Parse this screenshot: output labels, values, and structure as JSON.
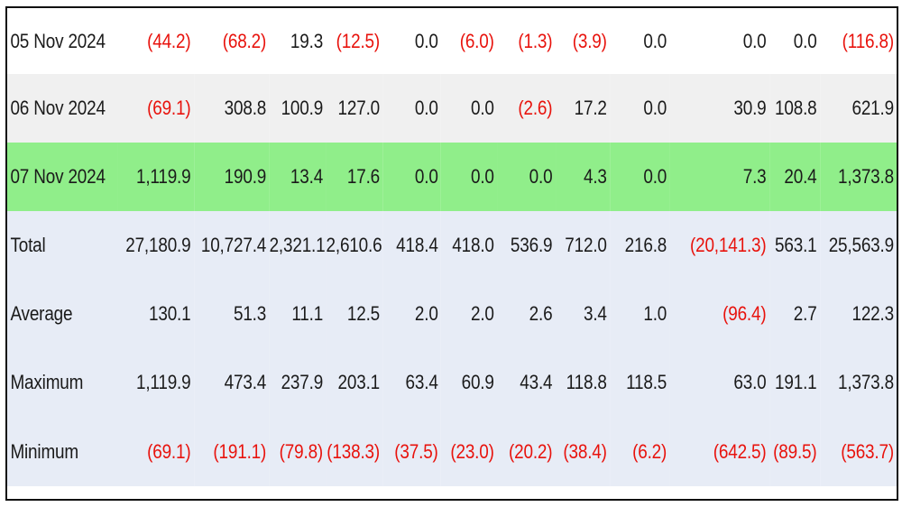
{
  "table": {
    "rows": [
      {
        "label": "05 Nov 2024",
        "style": "white",
        "cells": [
          {
            "v": "(44.2)",
            "neg": true
          },
          {
            "v": "(68.2)",
            "neg": true
          },
          {
            "v": "19.3",
            "neg": false
          },
          {
            "v": "(12.5)",
            "neg": true
          },
          {
            "v": "0.0",
            "neg": false
          },
          {
            "v": "(6.0)",
            "neg": true
          },
          {
            "v": "(1.3)",
            "neg": true
          },
          {
            "v": "(3.9)",
            "neg": true
          },
          {
            "v": "0.0",
            "neg": false
          },
          {
            "v": "0.0",
            "neg": false
          },
          {
            "v": "0.0",
            "neg": false
          },
          {
            "v": "(116.8)",
            "neg": true
          }
        ]
      },
      {
        "label": "06 Nov 2024",
        "style": "grey",
        "cells": [
          {
            "v": "(69.1)",
            "neg": true
          },
          {
            "v": "308.8",
            "neg": false
          },
          {
            "v": "100.9",
            "neg": false
          },
          {
            "v": "127.0",
            "neg": false
          },
          {
            "v": "0.0",
            "neg": false
          },
          {
            "v": "0.0",
            "neg": false
          },
          {
            "v": "(2.6)",
            "neg": true
          },
          {
            "v": "17.2",
            "neg": false
          },
          {
            "v": "0.0",
            "neg": false
          },
          {
            "v": "30.9",
            "neg": false
          },
          {
            "v": "108.8",
            "neg": false
          },
          {
            "v": "621.9",
            "neg": false
          }
        ]
      },
      {
        "label": "07 Nov 2024",
        "style": "green",
        "cells": [
          {
            "v": "1,119.9",
            "neg": false
          },
          {
            "v": "190.9",
            "neg": false
          },
          {
            "v": "13.4",
            "neg": false
          },
          {
            "v": "17.6",
            "neg": false
          },
          {
            "v": "0.0",
            "neg": false
          },
          {
            "v": "0.0",
            "neg": false
          },
          {
            "v": "0.0",
            "neg": false
          },
          {
            "v": "4.3",
            "neg": false
          },
          {
            "v": "0.0",
            "neg": false
          },
          {
            "v": "7.3",
            "neg": false
          },
          {
            "v": "20.4",
            "neg": false
          },
          {
            "v": "1,373.8",
            "neg": false
          }
        ]
      },
      {
        "label": "Total",
        "style": "summary",
        "cells": [
          {
            "v": "27,180.9",
            "neg": false
          },
          {
            "v": "10,727.4",
            "neg": false
          },
          {
            "v": "2,321.1",
            "neg": false
          },
          {
            "v": "2,610.6",
            "neg": false
          },
          {
            "v": "418.4",
            "neg": false
          },
          {
            "v": "418.0",
            "neg": false
          },
          {
            "v": "536.9",
            "neg": false
          },
          {
            "v": "712.0",
            "neg": false
          },
          {
            "v": "216.8",
            "neg": false
          },
          {
            "v": "(20,141.3)",
            "neg": true
          },
          {
            "v": "563.1",
            "neg": false
          },
          {
            "v": "25,563.9",
            "neg": false
          }
        ]
      },
      {
        "label": "Average",
        "style": "summary",
        "cells": [
          {
            "v": "130.1",
            "neg": false
          },
          {
            "v": "51.3",
            "neg": false
          },
          {
            "v": "11.1",
            "neg": false
          },
          {
            "v": "12.5",
            "neg": false
          },
          {
            "v": "2.0",
            "neg": false
          },
          {
            "v": "2.0",
            "neg": false
          },
          {
            "v": "2.6",
            "neg": false
          },
          {
            "v": "3.4",
            "neg": false
          },
          {
            "v": "1.0",
            "neg": false
          },
          {
            "v": "(96.4)",
            "neg": true
          },
          {
            "v": "2.7",
            "neg": false
          },
          {
            "v": "122.3",
            "neg": false
          }
        ]
      },
      {
        "label": "Maximum",
        "style": "summary",
        "cells": [
          {
            "v": "1,119.9",
            "neg": false
          },
          {
            "v": "473.4",
            "neg": false
          },
          {
            "v": "237.9",
            "neg": false
          },
          {
            "v": "203.1",
            "neg": false
          },
          {
            "v": "63.4",
            "neg": false
          },
          {
            "v": "60.9",
            "neg": false
          },
          {
            "v": "43.4",
            "neg": false
          },
          {
            "v": "118.8",
            "neg": false
          },
          {
            "v": "118.5",
            "neg": false
          },
          {
            "v": "63.0",
            "neg": false
          },
          {
            "v": "191.1",
            "neg": false
          },
          {
            "v": "1,373.8",
            "neg": false
          }
        ]
      },
      {
        "label": "Minimum",
        "style": "summary",
        "cells": [
          {
            "v": "(69.1)",
            "neg": true
          },
          {
            "v": "(191.1)",
            "neg": true
          },
          {
            "v": "(79.8)",
            "neg": true
          },
          {
            "v": "(138.3)",
            "neg": true
          },
          {
            "v": "(37.5)",
            "neg": true
          },
          {
            "v": "(23.0)",
            "neg": true
          },
          {
            "v": "(20.2)",
            "neg": true
          },
          {
            "v": "(38.4)",
            "neg": true
          },
          {
            "v": "(6.2)",
            "neg": true
          },
          {
            "v": "(642.5)",
            "neg": true
          },
          {
            "v": "(89.5)",
            "neg": true
          },
          {
            "v": "(563.7)",
            "neg": true
          }
        ]
      }
    ]
  },
  "colors": {
    "negative_text": "#e8120c",
    "highlight_row": "#90ee8a",
    "alt_row": "#f0f0f0",
    "summary_row": "#e7ecf6"
  }
}
